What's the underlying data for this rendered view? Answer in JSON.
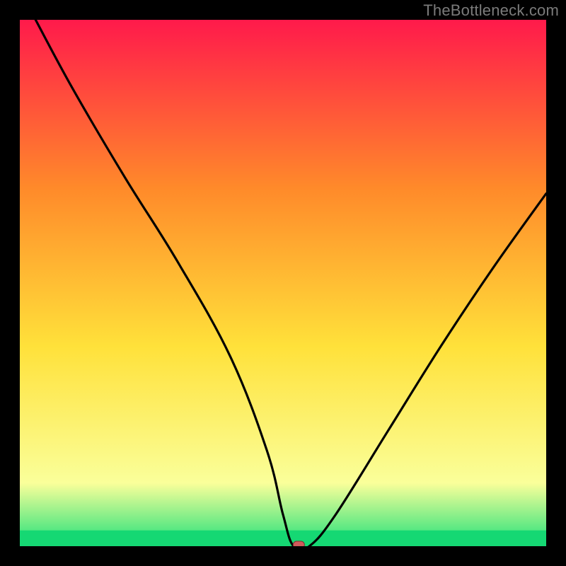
{
  "watermark": "TheBottleneck.com",
  "chart_data": {
    "type": "line",
    "title": "",
    "xlabel": "",
    "ylabel": "",
    "xlim": [
      0,
      100
    ],
    "ylim": [
      0,
      100
    ],
    "x": [
      3,
      10,
      20,
      30,
      40,
      47,
      50,
      52,
      55,
      60,
      70,
      80,
      90,
      100
    ],
    "values": [
      100,
      87,
      70,
      54,
      36,
      18,
      6,
      0,
      0,
      6,
      22,
      38,
      53,
      67
    ],
    "marker": {
      "x": 53,
      "y": 0,
      "color": "#cf5b5b"
    },
    "green_band": {
      "y_start": 0,
      "y_end": 3
    },
    "gradient": {
      "top": "#ff1a4b",
      "mid1": "#ff8a2a",
      "mid2": "#ffe13a",
      "low": "#faff9a",
      "bottom": "#1fe07a"
    }
  }
}
